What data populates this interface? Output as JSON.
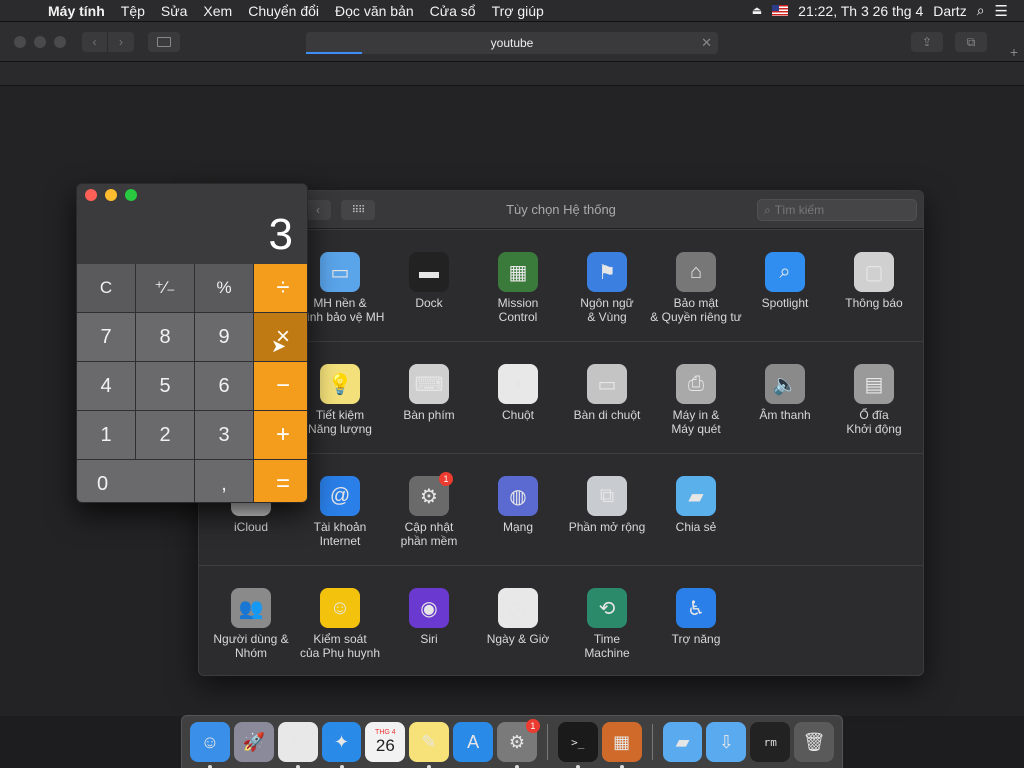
{
  "menubar": {
    "apple": "",
    "items": [
      "Máy tính",
      "Tệp",
      "Sửa",
      "Xem",
      "Chuyển đổi",
      "Đọc văn bản",
      "Cửa sổ",
      "Trợ giúp"
    ],
    "clock": "21:22, Th 3 26 thg 4",
    "user": "Dartz"
  },
  "browser": {
    "url_text": "youtube",
    "close": "✕",
    "back": "‹",
    "forward": "›",
    "share": "⇪",
    "tabs": "⧉",
    "plus": "+"
  },
  "prefs": {
    "title": "Tùy chọn Hệ thống",
    "search_placeholder": "Tìm kiếm",
    "back": "‹",
    "grid": "⠿⠿",
    "row1": [
      {
        "label": "MH nền &\nTrình bảo vệ MH",
        "icon": "desktop-icon",
        "color": "#5aa4ea"
      },
      {
        "label": "Dock",
        "icon": "dock-icon",
        "color": "#222"
      },
      {
        "label": "Mission\nControl",
        "icon": "mission-control-icon",
        "color": "#3a7a3a"
      },
      {
        "label": "Ngôn ngữ\n& Vùng",
        "icon": "flag-globe-icon",
        "color": "#3b7fe0"
      },
      {
        "label": "Bảo mật\n& Quyền riêng tư",
        "icon": "house-lock-icon",
        "color": "#777"
      },
      {
        "label": "Spotlight",
        "icon": "magnifier-icon",
        "color": "#2f8ef0"
      },
      {
        "label": "Thông báo",
        "icon": "notification-icon",
        "color": "#d0d0d0"
      }
    ],
    "row2": [
      {
        "label": "Tiết kiệm\nNăng lượng",
        "icon": "bulb-icon",
        "color": "#f3e07a"
      },
      {
        "label": "Bàn phím",
        "icon": "keyboard-icon",
        "color": "#cfcfcf"
      },
      {
        "label": "Chuột",
        "icon": "mouse-icon",
        "color": "#e8e8e8"
      },
      {
        "label": "Bàn di chuột",
        "icon": "trackpad-icon",
        "color": "#c4c4c4"
      },
      {
        "label": "Máy in &\nMáy quét",
        "icon": "printer-icon",
        "color": "#a9a9a9"
      },
      {
        "label": "Âm thanh",
        "icon": "speaker-icon",
        "color": "#8a8a8a"
      },
      {
        "label": "Ổ đĩa\nKhởi động",
        "icon": "disk-icon",
        "color": "#9a9a9a"
      }
    ],
    "row3": [
      {
        "label": "iCloud",
        "icon": "cloud-icon",
        "color": "#dcdcdc"
      },
      {
        "label": "Tài khoản\nInternet",
        "icon": "at-icon",
        "color": "#2a7fe8"
      },
      {
        "label": "Cập nhật\nphần mềm",
        "icon": "gear-icon",
        "color": "#6a6a6a",
        "badge": "1"
      },
      {
        "label": "Mạng",
        "icon": "globe-icon",
        "color": "#5a6ad0"
      },
      {
        "label": "Phần mở rộng",
        "icon": "puzzle-icon",
        "color": "#c8ccd0"
      },
      {
        "label": "Chia sẻ",
        "icon": "folder-share-icon",
        "color": "#5ab0ea"
      }
    ],
    "row4": [
      {
        "label": "Người dùng &\nNhóm",
        "icon": "users-icon",
        "color": "#8a8a8a"
      },
      {
        "label": "Kiểm soát\ncủa Phụ huynh",
        "icon": "parental-icon",
        "color": "#f2c20c"
      },
      {
        "label": "Siri",
        "icon": "siri-icon",
        "color": "#6a3ad0"
      },
      {
        "label": "Ngày & Giờ",
        "icon": "clock-icon",
        "color": "#e8e8e8"
      },
      {
        "label": "Time\nMachine",
        "icon": "time-machine-icon",
        "color": "#2a8a6a"
      },
      {
        "label": "Trợ năng",
        "icon": "accessibility-icon",
        "color": "#2a7fe8"
      }
    ]
  },
  "calculator": {
    "display": "3",
    "keys": [
      {
        "label": "C",
        "kind": "fn"
      },
      {
        "label": "⁺∕₋",
        "kind": "fn"
      },
      {
        "label": "%",
        "kind": "fn"
      },
      {
        "label": "÷",
        "kind": "op"
      },
      {
        "label": "7",
        "kind": "num"
      },
      {
        "label": "8",
        "kind": "num"
      },
      {
        "label": "9",
        "kind": "num"
      },
      {
        "label": "×",
        "kind": "op",
        "hover": true
      },
      {
        "label": "4",
        "kind": "num"
      },
      {
        "label": "5",
        "kind": "num"
      },
      {
        "label": "6",
        "kind": "num"
      },
      {
        "label": "−",
        "kind": "op"
      },
      {
        "label": "1",
        "kind": "num"
      },
      {
        "label": "2",
        "kind": "num"
      },
      {
        "label": "3",
        "kind": "num"
      },
      {
        "label": "+",
        "kind": "op"
      },
      {
        "label": "0",
        "kind": "zero"
      },
      {
        "label": ",",
        "kind": "num"
      },
      {
        "label": "=",
        "kind": "op"
      }
    ]
  },
  "dock": {
    "apps": [
      {
        "name": "finder-icon",
        "color": "#3a8fe8",
        "running": true
      },
      {
        "name": "launchpad-icon",
        "color": "#8a8a9a",
        "running": false
      },
      {
        "name": "chrome-icon",
        "color": "#e8e8e8",
        "running": true
      },
      {
        "name": "safari-icon",
        "color": "#2a8ae8",
        "running": true
      },
      {
        "name": "calendar-icon",
        "color": "#f2f2f2",
        "running": false,
        "text": "26",
        "month": "THG 4"
      },
      {
        "name": "notes-icon",
        "color": "#f7e27a",
        "running": true
      },
      {
        "name": "app-store-icon",
        "color": "#2a8ae8",
        "running": false
      },
      {
        "name": "system-preferences-icon",
        "color": "#7a7a7a",
        "running": true,
        "badge": "1"
      }
    ],
    "apps2": [
      {
        "name": "terminal-icon",
        "color": "#1a1a1a",
        "running": true,
        "text": ">_"
      },
      {
        "name": "calculator-icon",
        "color": "#d06a2a",
        "running": true
      }
    ],
    "stacks": [
      {
        "name": "applications-folder-icon",
        "color": "#5aaaf0"
      },
      {
        "name": "downloads-folder-icon",
        "color": "#5aaaf0"
      },
      {
        "name": "terminal-window-icon",
        "color": "#222",
        "text": "rm"
      },
      {
        "name": "trash-icon",
        "color": "#5a5a5a"
      }
    ]
  }
}
